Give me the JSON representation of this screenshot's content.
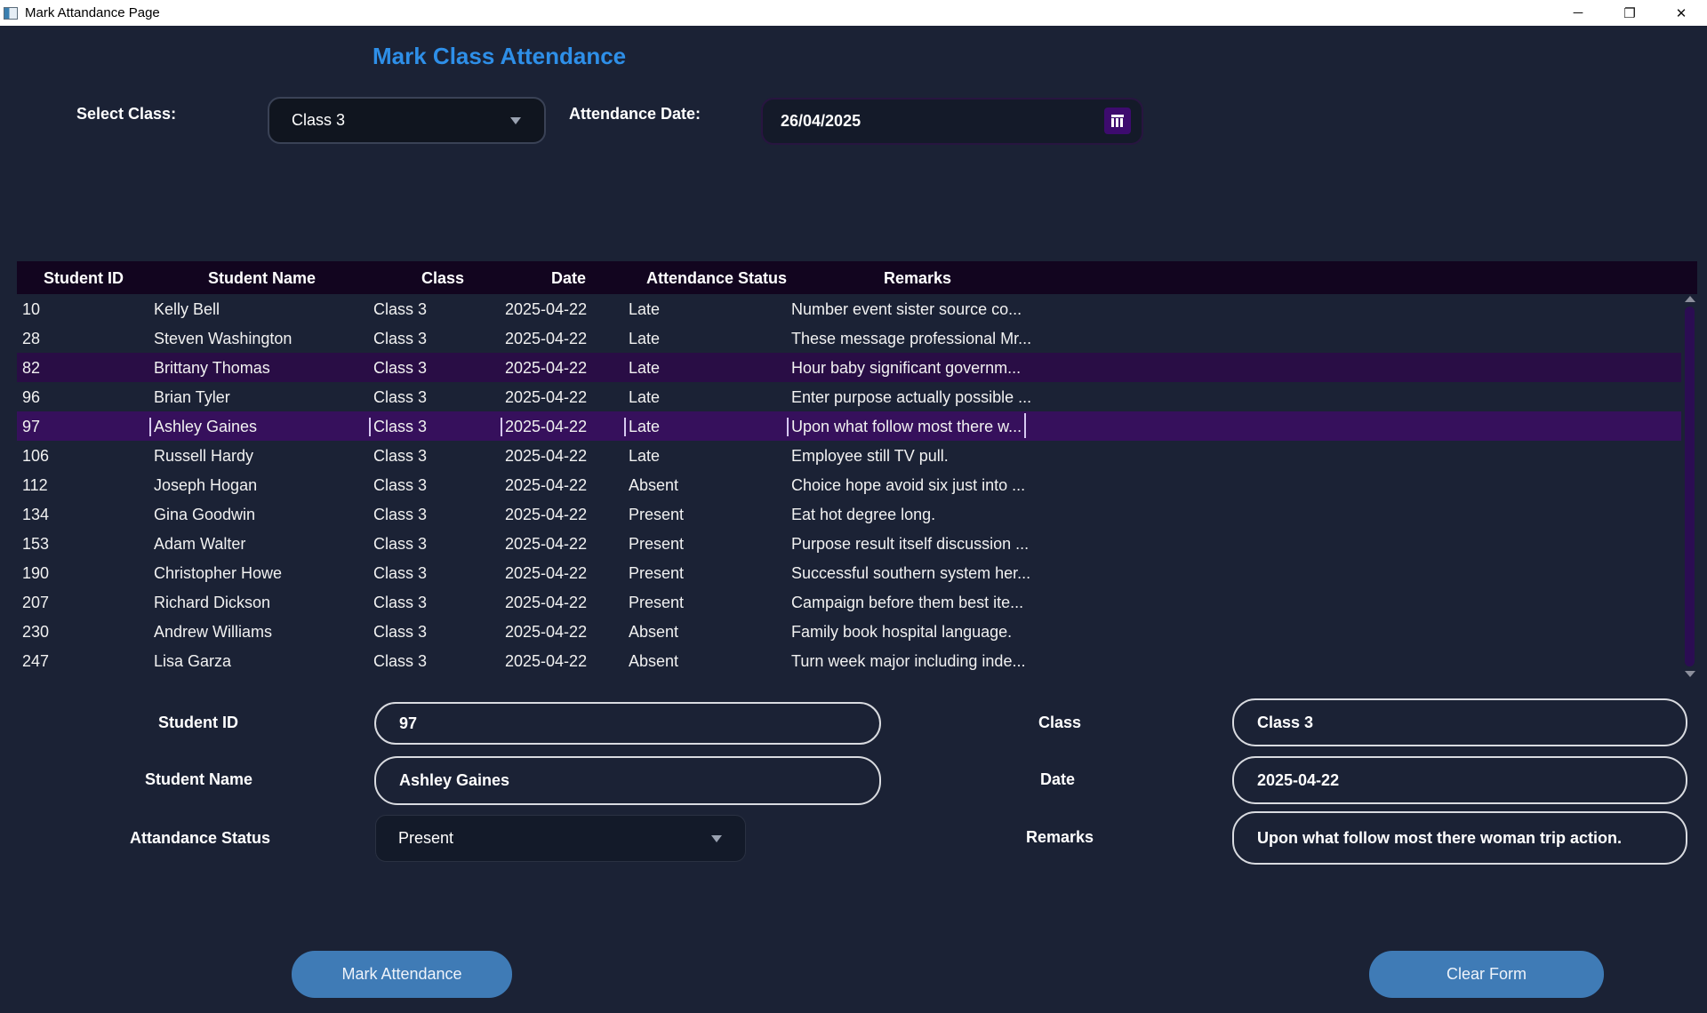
{
  "window": {
    "title": "Mark Attandance Page",
    "minimize_glyph": "─",
    "restore_glyph": "❐",
    "close_glyph": "✕"
  },
  "header": {
    "title": "Mark Class Attendance",
    "select_class_label": "Select Class:",
    "selected_class": "Class 3",
    "attendance_date_label": "Attendance Date:",
    "attendance_date": "26/04/2025"
  },
  "table": {
    "columns": [
      "Student ID",
      "Student Name",
      "Class",
      "Date",
      "Attendance Status",
      "Remarks"
    ],
    "rows": [
      [
        "10",
        "Kelly Bell",
        "Class 3",
        "2025-04-22",
        "Late",
        "Number event sister source co..."
      ],
      [
        "28",
        "Steven Washington",
        "Class 3",
        "2025-04-22",
        "Late",
        "These message professional Mr..."
      ],
      [
        "82",
        "Brittany Thomas",
        "Class 3",
        "2025-04-22",
        "Late",
        "Hour baby significant governm..."
      ],
      [
        "96",
        "Brian Tyler",
        "Class 3",
        "2025-04-22",
        "Late",
        "Enter purpose actually possible ..."
      ],
      [
        "97",
        "Ashley Gaines",
        "Class 3",
        "2025-04-22",
        "Late",
        "Upon what follow most there w..."
      ],
      [
        "106",
        "Russell Hardy",
        "Class 3",
        "2025-04-22",
        "Late",
        "Employee still TV pull."
      ],
      [
        "112",
        "Joseph Hogan",
        "Class 3",
        "2025-04-22",
        "Absent",
        "Choice hope avoid six just into ..."
      ],
      [
        "134",
        "Gina Goodwin",
        "Class 3",
        "2025-04-22",
        "Present",
        "Eat hot degree long."
      ],
      [
        "153",
        "Adam Walter",
        "Class 3",
        "2025-04-22",
        "Present",
        "Purpose result itself discussion ..."
      ],
      [
        "190",
        "Christopher Howe",
        "Class 3",
        "2025-04-22",
        "Present",
        "Successful southern system her..."
      ],
      [
        "207",
        "Richard Dickson",
        "Class 3",
        "2025-04-22",
        "Present",
        "Campaign before them best ite..."
      ],
      [
        "230",
        "Andrew Williams",
        "Class 3",
        "2025-04-22",
        "Absent",
        "Family book hospital language."
      ],
      [
        "247",
        "Lisa Garza",
        "Class 3",
        "2025-04-22",
        "Absent",
        "Turn week major including inde..."
      ]
    ],
    "highlighted_row_index": 2,
    "selected_row_index": 4
  },
  "form": {
    "student_id_label": "Student ID",
    "student_id": "97",
    "student_name_label": "Student Name",
    "student_name": "Ashley Gaines",
    "status_label": "Attandance Status",
    "status": "Present",
    "class_label": "Class",
    "class": "Class 3",
    "date_label": "Date",
    "date": "2025-04-22",
    "remarks_label": "Remarks",
    "remarks": "Upon what follow most there woman trip action."
  },
  "buttons": {
    "mark_attendance": "Mark Attendance",
    "clear_form": "Clear Form"
  },
  "colors": {
    "background": "#1b2235",
    "title": "#2e8fe8",
    "table_header": "#12051f",
    "selected_row": "#36105c",
    "button": "#3f7bb6"
  }
}
